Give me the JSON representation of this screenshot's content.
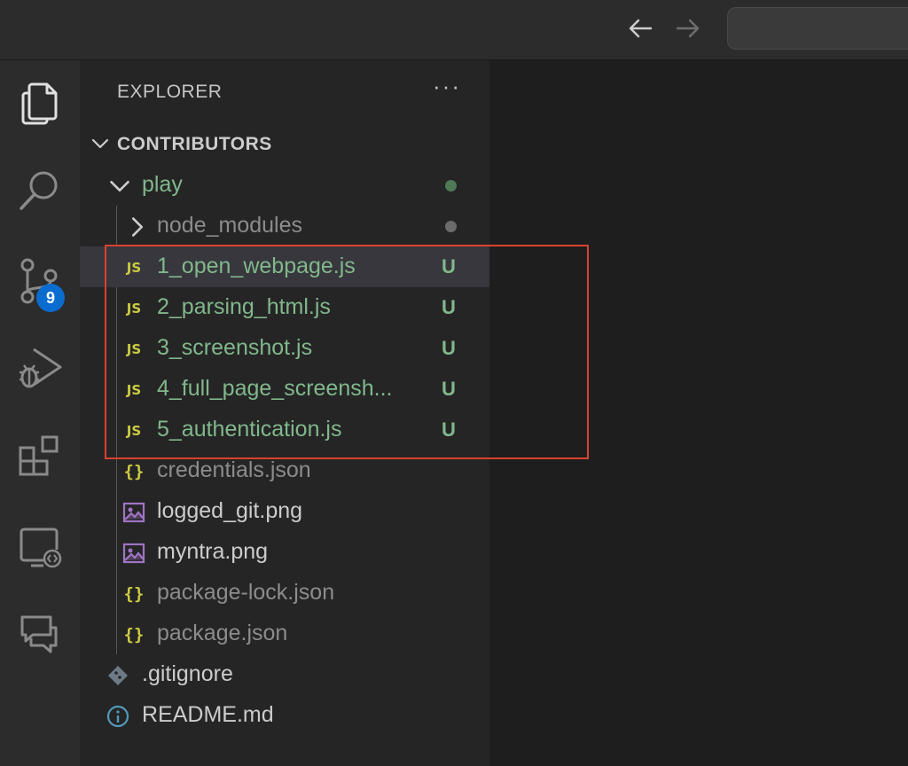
{
  "titlebar": {
    "back_icon": "arrow-left-icon",
    "forward_icon": "arrow-right-icon"
  },
  "activity_bar": {
    "items": [
      {
        "name": "explorer",
        "icon": "files-icon"
      },
      {
        "name": "search",
        "icon": "search-icon"
      },
      {
        "name": "source-control",
        "icon": "source-control-icon",
        "badge": "9"
      },
      {
        "name": "run-debug",
        "icon": "run-debug-icon"
      },
      {
        "name": "extensions",
        "icon": "extensions-icon"
      },
      {
        "name": "remote-explorer",
        "icon": "remote-explorer-icon"
      },
      {
        "name": "comments",
        "icon": "comments-icon"
      }
    ]
  },
  "sidebar": {
    "header": "EXPLORER",
    "more": "···",
    "section_title": "CONTRIBUTORS",
    "tree": [
      {
        "label": "play",
        "type": "folder-open",
        "color": "#81b88b",
        "dot": "#4e7a57"
      },
      {
        "label": "node_modules",
        "type": "folder-closed",
        "color": "#8c8c8c",
        "dot": "#6b6b6b"
      },
      {
        "label": "1_open_webpage.js",
        "type": "js",
        "color": "#81b88b",
        "status": "U",
        "selected": true
      },
      {
        "label": "2_parsing_html.js",
        "type": "js",
        "color": "#81b88b",
        "status": "U"
      },
      {
        "label": "3_screenshot.js",
        "type": "js",
        "color": "#81b88b",
        "status": "U"
      },
      {
        "label": "4_full_page_screensh...",
        "type": "js",
        "color": "#81b88b",
        "status": "U"
      },
      {
        "label": "5_authentication.js",
        "type": "js",
        "color": "#81b88b",
        "status": "U"
      },
      {
        "label": "credentials.json",
        "type": "json",
        "color": "#8c8c8c"
      },
      {
        "label": "logged_git.png",
        "type": "image",
        "color": "#cccccc"
      },
      {
        "label": "myntra.png",
        "type": "image",
        "color": "#cccccc"
      },
      {
        "label": "package-lock.json",
        "type": "json",
        "color": "#8c8c8c"
      },
      {
        "label": "package.json",
        "type": "json",
        "color": "#8c8c8c"
      },
      {
        "label": ".gitignore",
        "type": "git",
        "color": "#cccccc"
      },
      {
        "label": "README.md",
        "type": "info",
        "color": "#cccccc"
      }
    ],
    "js_badge": "JS",
    "json_badge": "{}"
  },
  "colors": {
    "status_untracked": "#81b88b",
    "highlight": "#d9432f",
    "badge": "#0a6ccf"
  }
}
